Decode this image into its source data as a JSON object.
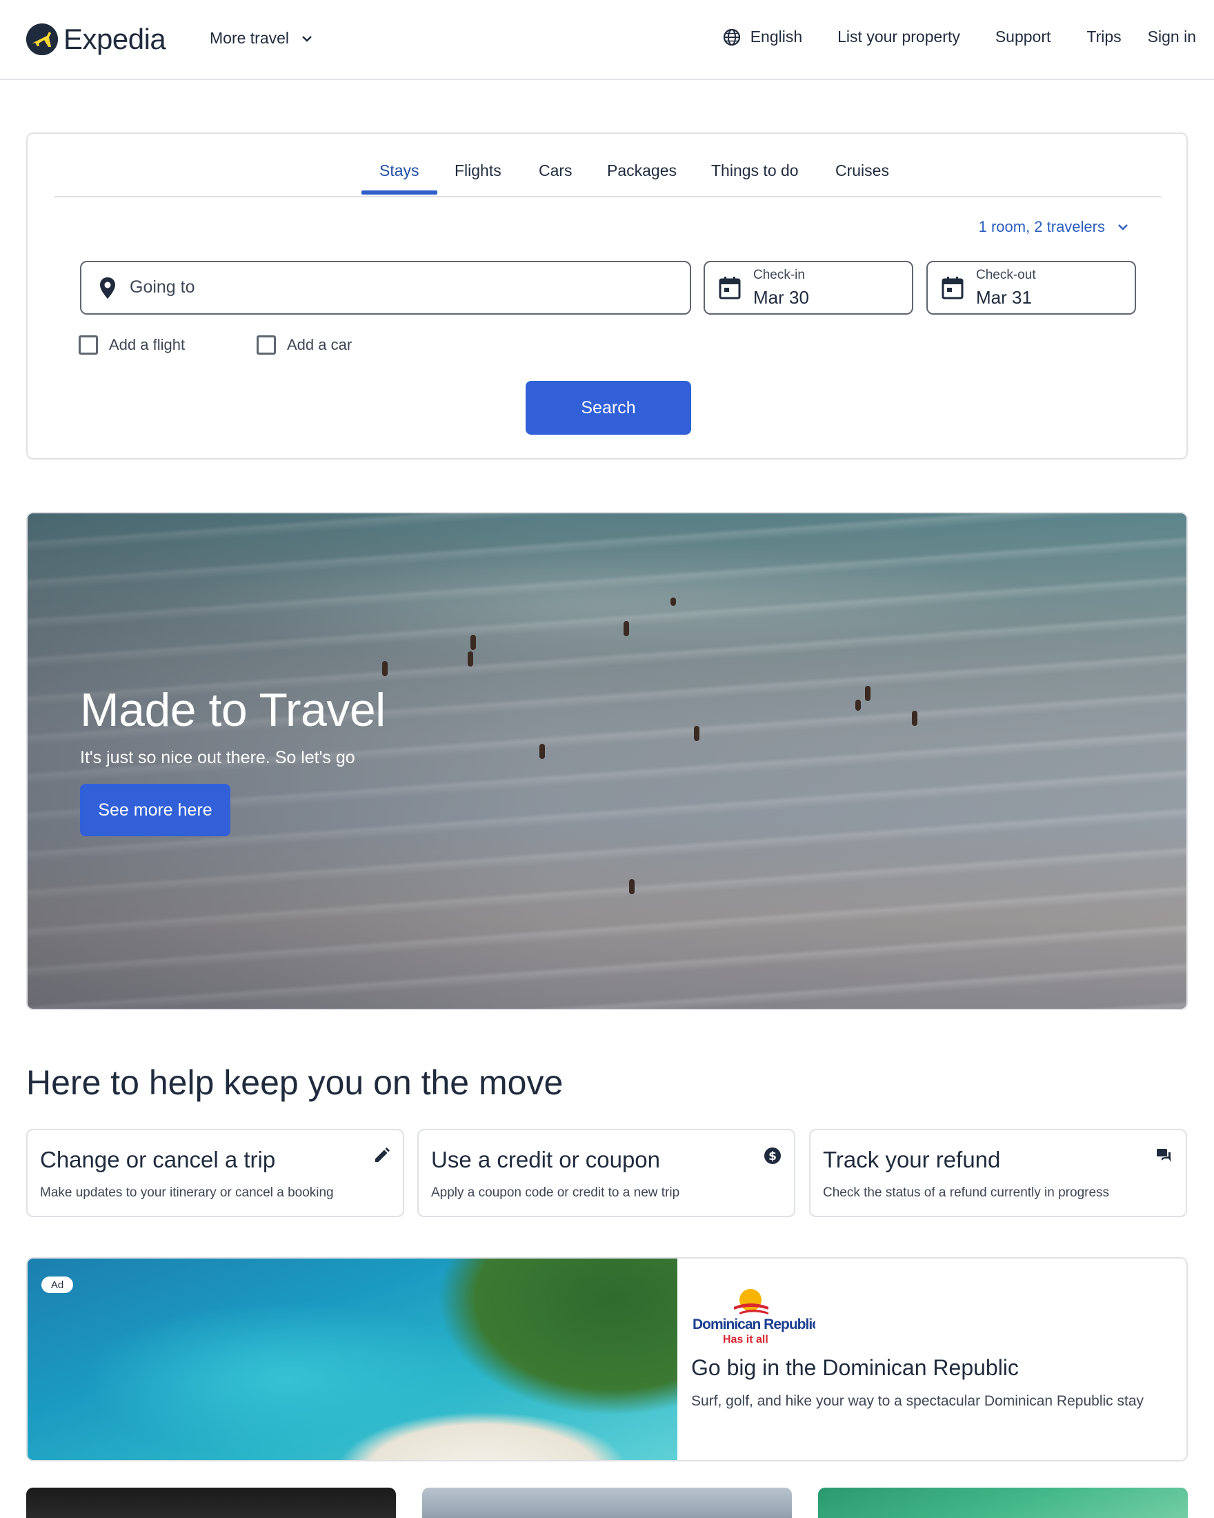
{
  "header": {
    "brand": "Expedia",
    "more_travel": "More travel",
    "language": "English",
    "list_property": "List your property",
    "support": "Support",
    "trips": "Trips",
    "sign_in": "Sign in"
  },
  "search": {
    "tabs": [
      {
        "label": "Stays",
        "active": true
      },
      {
        "label": "Flights"
      },
      {
        "label": "Cars"
      },
      {
        "label": "Packages"
      },
      {
        "label": "Things to do"
      },
      {
        "label": "Cruises"
      }
    ],
    "travelers": "1 room, 2 travelers",
    "going_to_placeholder": "Going to",
    "checkin_label": "Check-in",
    "checkin_value": "Mar 30",
    "checkout_label": "Check-out",
    "checkout_value": "Mar 31",
    "add_flight": "Add a flight",
    "add_car": "Add a car",
    "search_button": "Search"
  },
  "hero": {
    "title": "Made to Travel",
    "subtitle": "It's just so nice out there. So let's go",
    "button": "See more here"
  },
  "help": {
    "title": "Here to help keep you on the move",
    "cards": [
      {
        "title": "Change or cancel a trip",
        "desc": "Make updates to your itinerary or cancel a booking",
        "icon": "pencil-icon"
      },
      {
        "title": "Use a credit or coupon",
        "desc": "Apply a coupon code or credit to a new trip",
        "icon": "dollar-icon"
      },
      {
        "title": "Track your refund",
        "desc": "Check the status of a refund currently in progress",
        "icon": "chat-icon"
      }
    ]
  },
  "ad": {
    "badge": "Ad",
    "logo_line1": "Dominican Republic",
    "logo_line2": "Has it all",
    "title": "Go big in the Dominican Republic",
    "desc": "Surf, golf, and hike your way to a spectacular Dominican Republic stay"
  },
  "colors": {
    "brand_blue": "#3160d8",
    "active_tab": "#1f4fa7",
    "text_dark": "#1f2b3d"
  }
}
